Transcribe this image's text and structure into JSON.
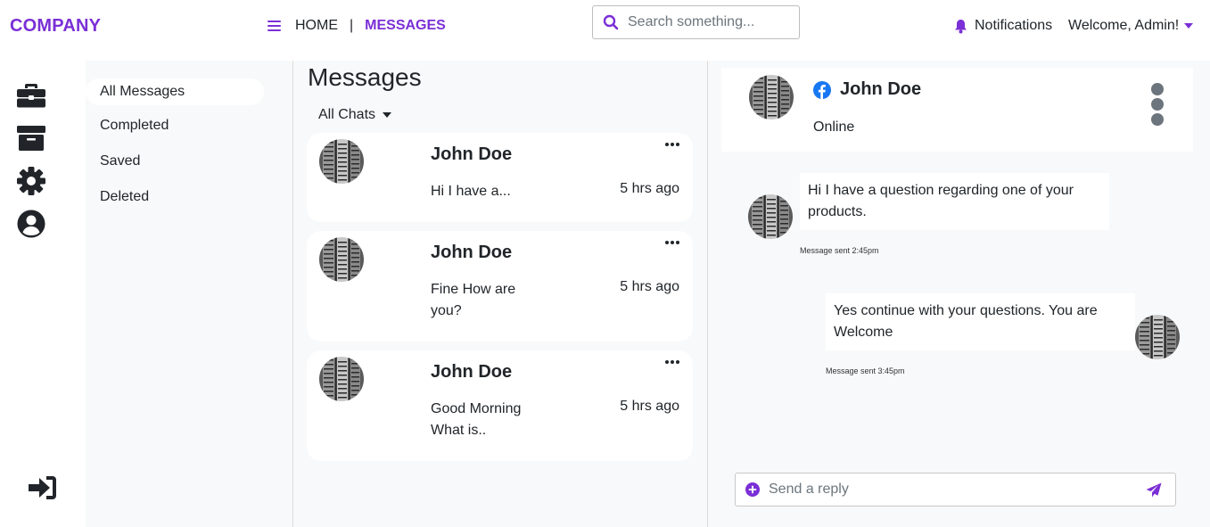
{
  "header": {
    "brand": "COMPANY",
    "nav_home": "HOME",
    "nav_separator": "|",
    "nav_active": "MESSAGES",
    "search_placeholder": "Search something...",
    "notifications": "Notifications",
    "welcome": "Welcome, Admin!"
  },
  "rail": {
    "icons": [
      "briefcase-icon",
      "archive-icon",
      "settings-icon",
      "user-circle-icon",
      "sign-in-icon"
    ]
  },
  "folders": {
    "items": [
      {
        "label": "All Messages",
        "active": true
      },
      {
        "label": "Completed",
        "active": false
      },
      {
        "label": "Saved",
        "active": false
      },
      {
        "label": "Deleted",
        "active": false
      }
    ]
  },
  "list": {
    "title": "Messages",
    "filter": "All Chats",
    "cards": [
      {
        "name": "John Doe",
        "snippet": "Hi I have a...",
        "time": "5 hrs ago"
      },
      {
        "name": "John Doe",
        "snippet": "Fine How are you?",
        "time": "5 hrs ago"
      },
      {
        "name": "John Doe",
        "snippet": "Good Morning What is..",
        "time": "5 hrs ago"
      }
    ]
  },
  "chat": {
    "contact_name": "John Doe",
    "contact_source_icon": "facebook-icon",
    "status": "Online",
    "messages": [
      {
        "text": "Hi I have a question regarding one of your products.",
        "meta": "Message sent 2:45pm",
        "from": "contact"
      },
      {
        "text": "Yes continue with your questions. You are Welcome",
        "meta": "Message sent 3:45pm",
        "from": "admin"
      }
    ],
    "reply_placeholder": "Send a reply"
  },
  "colors": {
    "accent": "#7b2fd6",
    "facebook": "#1877f2",
    "panel_bg": "#f8f9fa"
  }
}
